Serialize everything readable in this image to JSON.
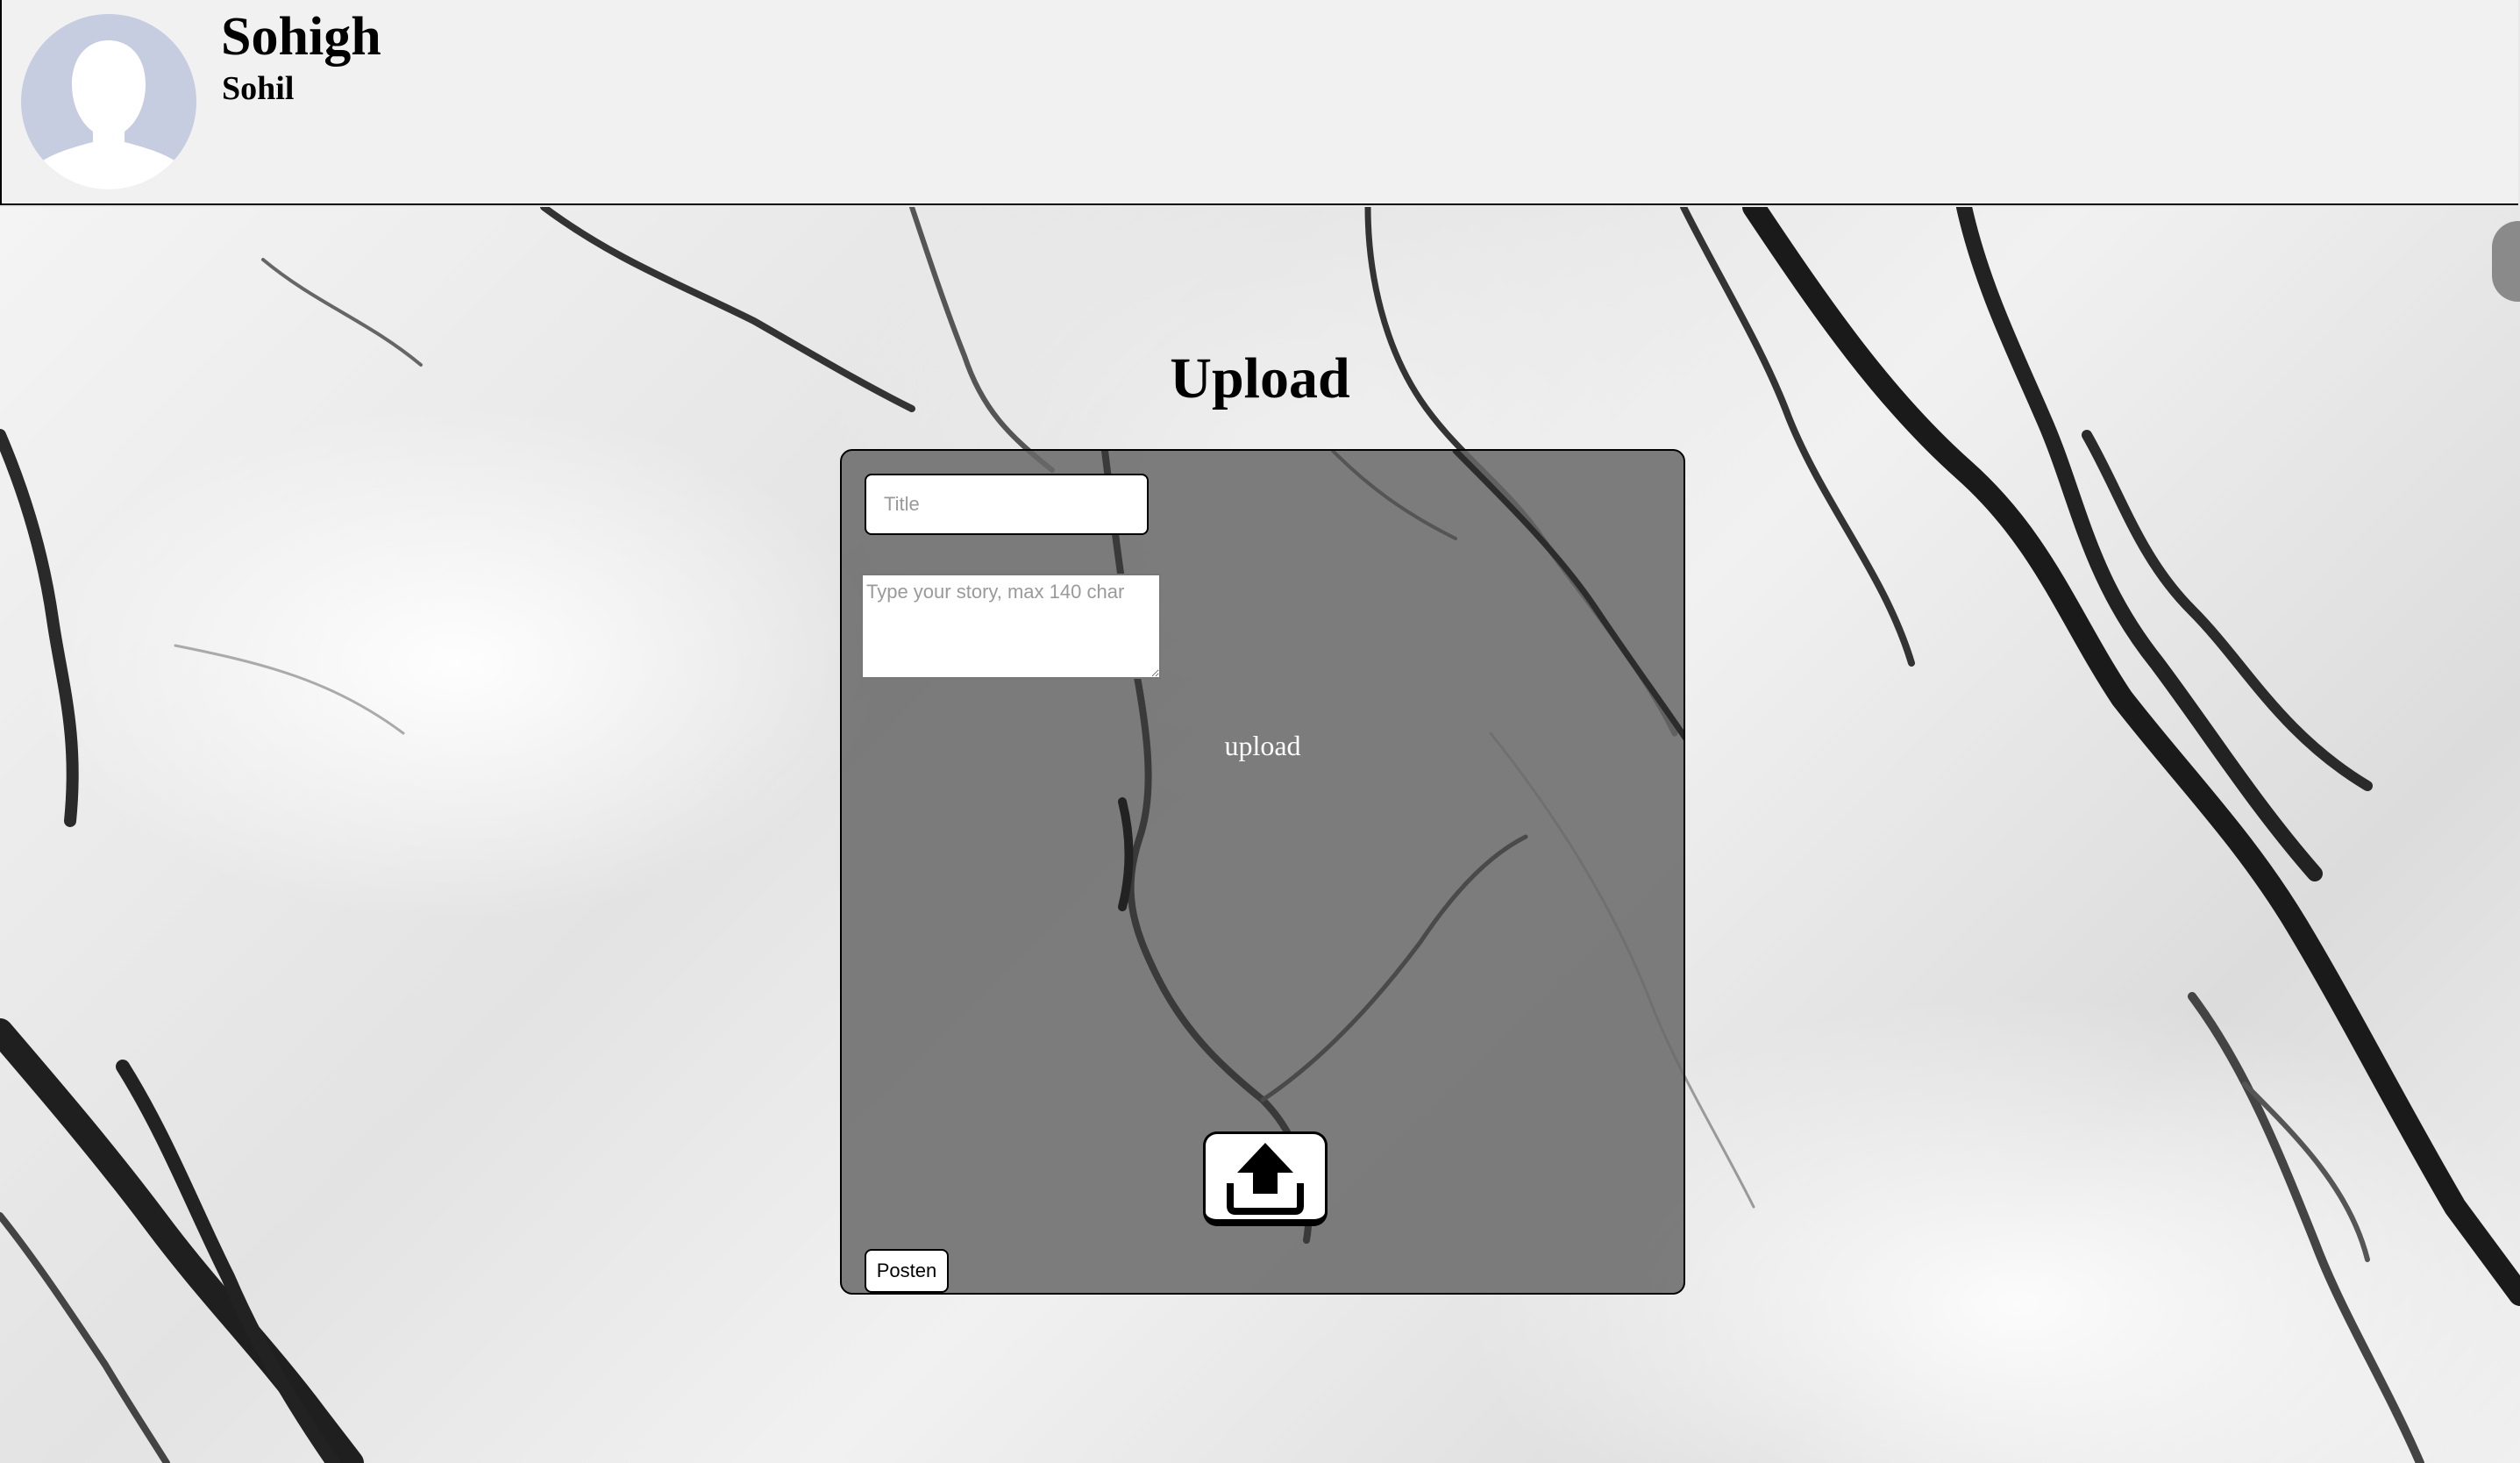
{
  "header": {
    "display_name": "Sohigh",
    "username": "Sohil",
    "avatar_icon": "default-avatar-silhouette-icon"
  },
  "page": {
    "title": "Upload"
  },
  "form": {
    "title_placeholder": "Title",
    "title_value": "",
    "story_placeholder": "Type your story, max 140 char",
    "story_value": "",
    "upload_label": "upload",
    "upload_icon": "upload-arrow-icon",
    "post_label": "Posten"
  },
  "colors": {
    "header_bg": "#f1f1f1",
    "avatar_bg": "#c6cde0",
    "panel_bg": "#6e6e6e",
    "text": "#000000",
    "upload_label_text": "#ffffff"
  }
}
